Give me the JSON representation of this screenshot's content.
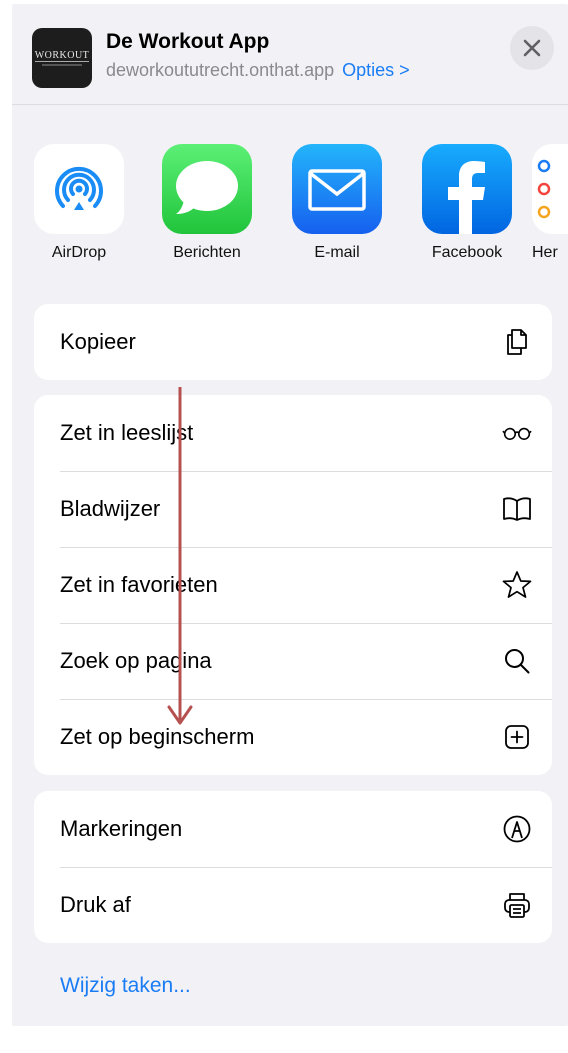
{
  "header": {
    "app_title": "De Workout App",
    "url": "deworkoututrecht.onthat.app",
    "options_link": "Opties >",
    "logo_text": "WORKOUT"
  },
  "share_apps": [
    {
      "label": "AirDrop",
      "icon": "airdrop-icon"
    },
    {
      "label": "Berichten",
      "icon": "messages-icon"
    },
    {
      "label": "E-mail",
      "icon": "mail-icon"
    },
    {
      "label": "Facebook",
      "icon": "facebook-icon"
    },
    {
      "label": "Her",
      "icon": "reminders-icon"
    }
  ],
  "group1": [
    {
      "label": "Kopieer",
      "icon": "copy-icon"
    }
  ],
  "group2": [
    {
      "label": "Zet in leeslijst",
      "icon": "glasses-icon"
    },
    {
      "label": "Bladwijzer",
      "icon": "book-icon"
    },
    {
      "label": "Zet in favorieten",
      "icon": "star-icon"
    },
    {
      "label": "Zoek op pagina",
      "icon": "search-icon"
    },
    {
      "label": "Zet op beginscherm",
      "icon": "add-square-icon"
    }
  ],
  "group3": [
    {
      "label": "Markeringen",
      "icon": "markup-icon"
    },
    {
      "label": "Druk af",
      "icon": "printer-icon"
    }
  ],
  "edit_actions": "Wijzig taken...",
  "colors": {
    "accent": "#1a7cf5",
    "sheet_bg": "#f2f2f6",
    "annotation_arrow": "#b5524f"
  }
}
